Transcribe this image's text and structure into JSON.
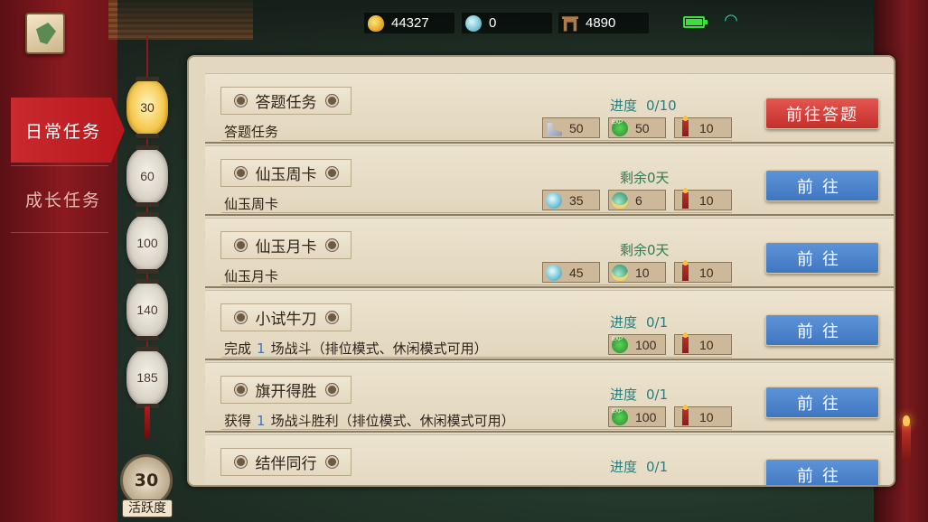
{
  "top_bar": {
    "gold": "44327",
    "jade": "0",
    "tokens": "4890"
  },
  "sidebar": {
    "tabs": [
      {
        "label": "日常任务",
        "active": true
      },
      {
        "label": "成长任务",
        "active": false
      }
    ]
  },
  "milestones": [
    {
      "value": "30",
      "lit": true
    },
    {
      "value": "60",
      "lit": false
    },
    {
      "value": "100",
      "lit": false
    },
    {
      "value": "140",
      "lit": false
    },
    {
      "value": "185",
      "lit": false
    }
  ],
  "activity": {
    "value": "30",
    "label": "活跃度"
  },
  "tasks": [
    {
      "title": "答题任务",
      "desc": "答题任务",
      "status_label": "进度",
      "status_value": "0/10",
      "rewards": [
        {
          "icon": "shoe-icon",
          "amount": "50"
        },
        {
          "icon": "exp-icon",
          "amount": "50"
        },
        {
          "icon": "candle-icon",
          "amount": "10"
        }
      ],
      "button": "前往答题",
      "button_style": "red"
    },
    {
      "title": "仙玉周卡",
      "desc": "仙玉周卡",
      "remaining": "剩余0天",
      "rewards": [
        {
          "icon": "jade-icon",
          "amount": "35"
        },
        {
          "icon": "egg-icon",
          "amount": "6"
        },
        {
          "icon": "candle-icon",
          "amount": "10"
        }
      ],
      "button": "前往",
      "button_style": "blue"
    },
    {
      "title": "仙玉月卡",
      "desc": "仙玉月卡",
      "remaining": "剩余0天",
      "rewards": [
        {
          "icon": "jade-icon",
          "amount": "45"
        },
        {
          "icon": "egg-icon",
          "amount": "10"
        },
        {
          "icon": "candle-icon",
          "amount": "10"
        }
      ],
      "button": "前往",
      "button_style": "blue"
    },
    {
      "title": "小试牛刀",
      "desc_pre": "完成",
      "desc_num": "1",
      "desc_post": "场战斗（排位模式、休闲模式可用）",
      "status_label": "进度",
      "status_value": "0/1",
      "rewards": [
        {
          "icon": "exp-icon",
          "amount": "100"
        },
        {
          "icon": "candle-icon",
          "amount": "10"
        }
      ],
      "button": "前往",
      "button_style": "blue"
    },
    {
      "title": "旗开得胜",
      "desc_pre": "获得",
      "desc_num": "1",
      "desc_post": "场战斗胜利（排位模式、休闲模式可用）",
      "status_label": "进度",
      "status_value": "0/1",
      "rewards": [
        {
          "icon": "exp-icon",
          "amount": "100"
        },
        {
          "icon": "candle-icon",
          "amount": "10"
        }
      ],
      "button": "前往",
      "button_style": "blue"
    },
    {
      "title": "结伴同行",
      "status_label": "进度",
      "status_value": "0/1",
      "button": "前往",
      "button_style": "blue"
    }
  ],
  "colors": {
    "accent_red": "#c3302b",
    "accent_blue": "#3f76c0",
    "progress_teal": "#2f7a7a",
    "panel_bg": "#e3d7bf"
  }
}
